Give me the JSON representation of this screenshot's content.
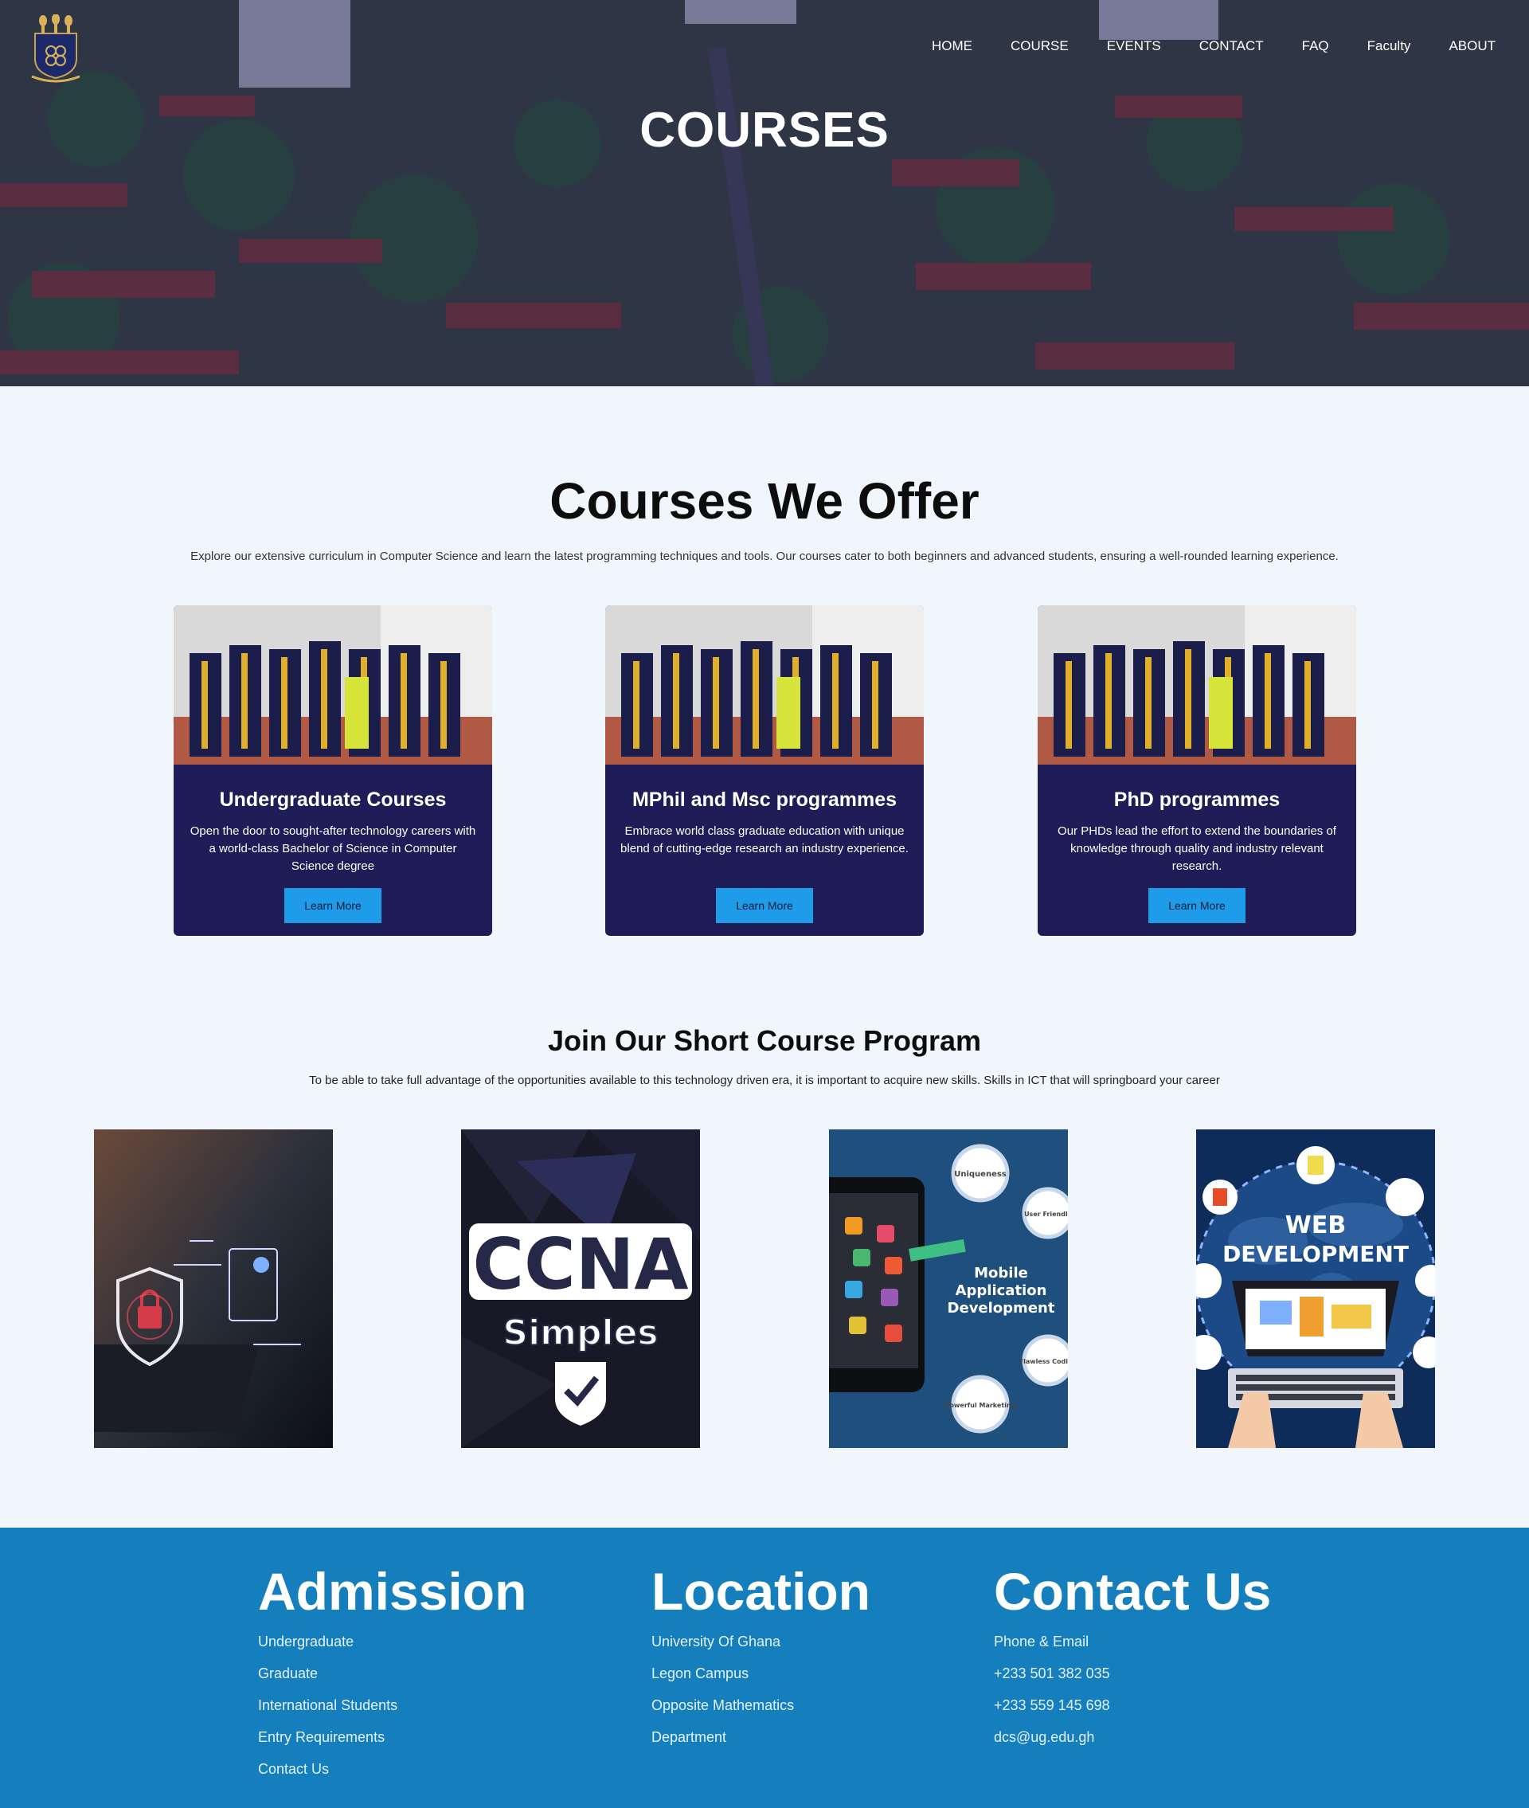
{
  "nav": {
    "items": [
      "HOME",
      "COURSE",
      "EVENTS",
      "CONTACT",
      "FAQ",
      "Faculty",
      "ABOUT"
    ]
  },
  "hero": {
    "title": "COURSES"
  },
  "offer": {
    "title": "Courses We Offer",
    "description": "Explore our extensive curriculum in Computer Science and learn the latest programming techniques and tools. Our courses cater to both beginners and advanced students, ensuring a well-rounded learning experience.",
    "cards": [
      {
        "title": "Undergraduate Courses",
        "text": "Open the door to sought-after technology careers with a world-class Bachelor of Science in Computer Science degree",
        "button": "Learn More"
      },
      {
        "title": "MPhil and Msc programmes",
        "text": "Embrace world class graduate education with unique blend of cutting-edge research an industry experience.",
        "button": "Learn More"
      },
      {
        "title": "PhD programmes",
        "text": "Our PHDs lead the effort to extend the boundaries of knowledge through quality and industry relevant research.",
        "button": "Learn More"
      }
    ]
  },
  "short": {
    "title": "Join Our Short Course Program",
    "description": "To be able to take full advantage of the opportunities available to this technology driven era, it is important to acquire new skills. Skills in ICT that will springboard your career",
    "tiles": {
      "ccna": {
        "big": "CCNA",
        "small": "Simples"
      },
      "mobile": {
        "line1": "Mobile",
        "line2": "Application",
        "line3": "Development",
        "bubbles": [
          "Uniqueness",
          "User Friendly",
          "Flawless Coding",
          "Powerful Marketing"
        ]
      },
      "web": {
        "line1": "WEB",
        "line2": "DEVELOPMENT"
      }
    }
  },
  "footer": {
    "admission": {
      "title": "Admission",
      "links": [
        "Undergraduate",
        "Graduate",
        "International Students",
        "Entry Requirements",
        "Contact Us"
      ]
    },
    "location": {
      "title": "Location",
      "links": [
        "University Of Ghana",
        "Legon Campus",
        "Opposite Mathematics",
        "Department"
      ]
    },
    "contact": {
      "title": "Contact Us",
      "links": [
        "Phone & Email",
        "+233 501 382 035",
        "+233 559 145 698",
        "dcs@ug.edu.gh"
      ]
    }
  },
  "colors": {
    "card_bg": "#1e1d57",
    "button": "#1e9be9",
    "footer": "#157ebd",
    "page_bg": "#f0f6fc"
  }
}
